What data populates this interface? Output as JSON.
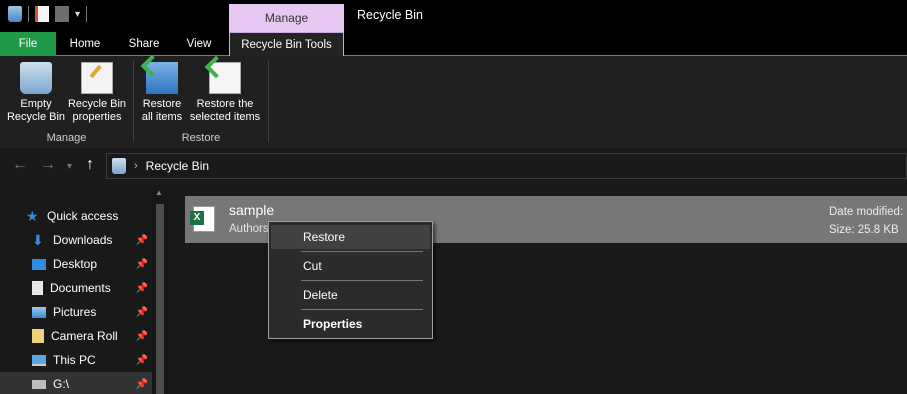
{
  "window": {
    "title": "Recycle Bin",
    "context_tab_group": "Manage"
  },
  "ribbon_tabs": [
    "File",
    "Home",
    "Share",
    "View",
    "Recycle Bin Tools"
  ],
  "ribbon": {
    "empty_bin": "Empty\nRecycle Bin",
    "bin_properties": "Recycle Bin\nproperties",
    "restore_all": "Restore\nall items",
    "restore_selected": "Restore the\nselected items",
    "group_manage": "Manage",
    "group_restore": "Restore"
  },
  "address": {
    "path": "Recycle Bin"
  },
  "nav": {
    "items": [
      {
        "label": "Quick access",
        "icon": "star-icon",
        "color": "#2f8de4"
      },
      {
        "label": "Downloads",
        "icon": "download-arrow-icon",
        "color": "#3b8fe0",
        "pinned": true
      },
      {
        "label": "Desktop",
        "icon": "desktop-folder-icon",
        "color": "#2d8ee0",
        "pinned": true
      },
      {
        "label": "Documents",
        "icon": "document-icon",
        "color": "#e8e8e8",
        "pinned": true
      },
      {
        "label": "Pictures",
        "icon": "pictures-icon",
        "color": "#5aa4ea",
        "pinned": true
      },
      {
        "label": "Camera Roll",
        "icon": "folder-icon",
        "color": "#f1d17a",
        "pinned": true
      },
      {
        "label": "This PC",
        "icon": "computer-icon",
        "color": "#57a6e8",
        "pinned": true
      },
      {
        "label": "G:\\",
        "icon": "drive-icon",
        "color": "#bdbdbd",
        "pinned": true
      }
    ]
  },
  "file": {
    "name": "sample",
    "author_label": "Authors",
    "date_label": "Date modified:",
    "size_label": "Size: 25.8 KB",
    "icon": "excel-file-icon"
  },
  "context_menu": {
    "restore": "Restore",
    "cut": "Cut",
    "delete": "Delete",
    "properties": "Properties"
  },
  "colors": {
    "file_tab": "#1f9a47",
    "manage_context": "#e6c8f2",
    "selection": "#777777"
  }
}
